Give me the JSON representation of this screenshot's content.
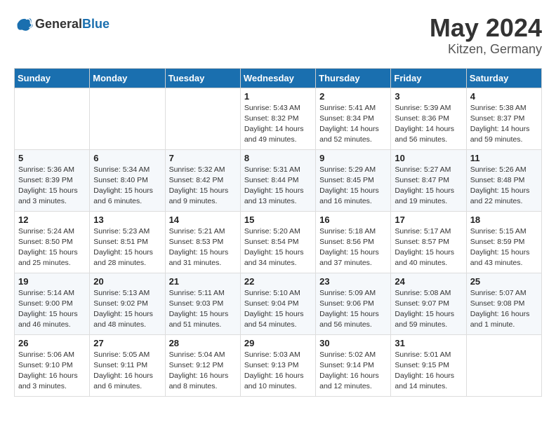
{
  "logo": {
    "general": "General",
    "blue": "Blue"
  },
  "title": "May 2024",
  "location": "Kitzen, Germany",
  "headers": [
    "Sunday",
    "Monday",
    "Tuesday",
    "Wednesday",
    "Thursday",
    "Friday",
    "Saturday"
  ],
  "weeks": [
    [
      {
        "day": "",
        "info": ""
      },
      {
        "day": "",
        "info": ""
      },
      {
        "day": "",
        "info": ""
      },
      {
        "day": "1",
        "info": "Sunrise: 5:43 AM\nSunset: 8:32 PM\nDaylight: 14 hours\nand 49 minutes."
      },
      {
        "day": "2",
        "info": "Sunrise: 5:41 AM\nSunset: 8:34 PM\nDaylight: 14 hours\nand 52 minutes."
      },
      {
        "day": "3",
        "info": "Sunrise: 5:39 AM\nSunset: 8:36 PM\nDaylight: 14 hours\nand 56 minutes."
      },
      {
        "day": "4",
        "info": "Sunrise: 5:38 AM\nSunset: 8:37 PM\nDaylight: 14 hours\nand 59 minutes."
      }
    ],
    [
      {
        "day": "5",
        "info": "Sunrise: 5:36 AM\nSunset: 8:39 PM\nDaylight: 15 hours\nand 3 minutes."
      },
      {
        "day": "6",
        "info": "Sunrise: 5:34 AM\nSunset: 8:40 PM\nDaylight: 15 hours\nand 6 minutes."
      },
      {
        "day": "7",
        "info": "Sunrise: 5:32 AM\nSunset: 8:42 PM\nDaylight: 15 hours\nand 9 minutes."
      },
      {
        "day": "8",
        "info": "Sunrise: 5:31 AM\nSunset: 8:44 PM\nDaylight: 15 hours\nand 13 minutes."
      },
      {
        "day": "9",
        "info": "Sunrise: 5:29 AM\nSunset: 8:45 PM\nDaylight: 15 hours\nand 16 minutes."
      },
      {
        "day": "10",
        "info": "Sunrise: 5:27 AM\nSunset: 8:47 PM\nDaylight: 15 hours\nand 19 minutes."
      },
      {
        "day": "11",
        "info": "Sunrise: 5:26 AM\nSunset: 8:48 PM\nDaylight: 15 hours\nand 22 minutes."
      }
    ],
    [
      {
        "day": "12",
        "info": "Sunrise: 5:24 AM\nSunset: 8:50 PM\nDaylight: 15 hours\nand 25 minutes."
      },
      {
        "day": "13",
        "info": "Sunrise: 5:23 AM\nSunset: 8:51 PM\nDaylight: 15 hours\nand 28 minutes."
      },
      {
        "day": "14",
        "info": "Sunrise: 5:21 AM\nSunset: 8:53 PM\nDaylight: 15 hours\nand 31 minutes."
      },
      {
        "day": "15",
        "info": "Sunrise: 5:20 AM\nSunset: 8:54 PM\nDaylight: 15 hours\nand 34 minutes."
      },
      {
        "day": "16",
        "info": "Sunrise: 5:18 AM\nSunset: 8:56 PM\nDaylight: 15 hours\nand 37 minutes."
      },
      {
        "day": "17",
        "info": "Sunrise: 5:17 AM\nSunset: 8:57 PM\nDaylight: 15 hours\nand 40 minutes."
      },
      {
        "day": "18",
        "info": "Sunrise: 5:15 AM\nSunset: 8:59 PM\nDaylight: 15 hours\nand 43 minutes."
      }
    ],
    [
      {
        "day": "19",
        "info": "Sunrise: 5:14 AM\nSunset: 9:00 PM\nDaylight: 15 hours\nand 46 minutes."
      },
      {
        "day": "20",
        "info": "Sunrise: 5:13 AM\nSunset: 9:02 PM\nDaylight: 15 hours\nand 48 minutes."
      },
      {
        "day": "21",
        "info": "Sunrise: 5:11 AM\nSunset: 9:03 PM\nDaylight: 15 hours\nand 51 minutes."
      },
      {
        "day": "22",
        "info": "Sunrise: 5:10 AM\nSunset: 9:04 PM\nDaylight: 15 hours\nand 54 minutes."
      },
      {
        "day": "23",
        "info": "Sunrise: 5:09 AM\nSunset: 9:06 PM\nDaylight: 15 hours\nand 56 minutes."
      },
      {
        "day": "24",
        "info": "Sunrise: 5:08 AM\nSunset: 9:07 PM\nDaylight: 15 hours\nand 59 minutes."
      },
      {
        "day": "25",
        "info": "Sunrise: 5:07 AM\nSunset: 9:08 PM\nDaylight: 16 hours\nand 1 minute."
      }
    ],
    [
      {
        "day": "26",
        "info": "Sunrise: 5:06 AM\nSunset: 9:10 PM\nDaylight: 16 hours\nand 3 minutes."
      },
      {
        "day": "27",
        "info": "Sunrise: 5:05 AM\nSunset: 9:11 PM\nDaylight: 16 hours\nand 6 minutes."
      },
      {
        "day": "28",
        "info": "Sunrise: 5:04 AM\nSunset: 9:12 PM\nDaylight: 16 hours\nand 8 minutes."
      },
      {
        "day": "29",
        "info": "Sunrise: 5:03 AM\nSunset: 9:13 PM\nDaylight: 16 hours\nand 10 minutes."
      },
      {
        "day": "30",
        "info": "Sunrise: 5:02 AM\nSunset: 9:14 PM\nDaylight: 16 hours\nand 12 minutes."
      },
      {
        "day": "31",
        "info": "Sunrise: 5:01 AM\nSunset: 9:15 PM\nDaylight: 16 hours\nand 14 minutes."
      },
      {
        "day": "",
        "info": ""
      }
    ]
  ]
}
